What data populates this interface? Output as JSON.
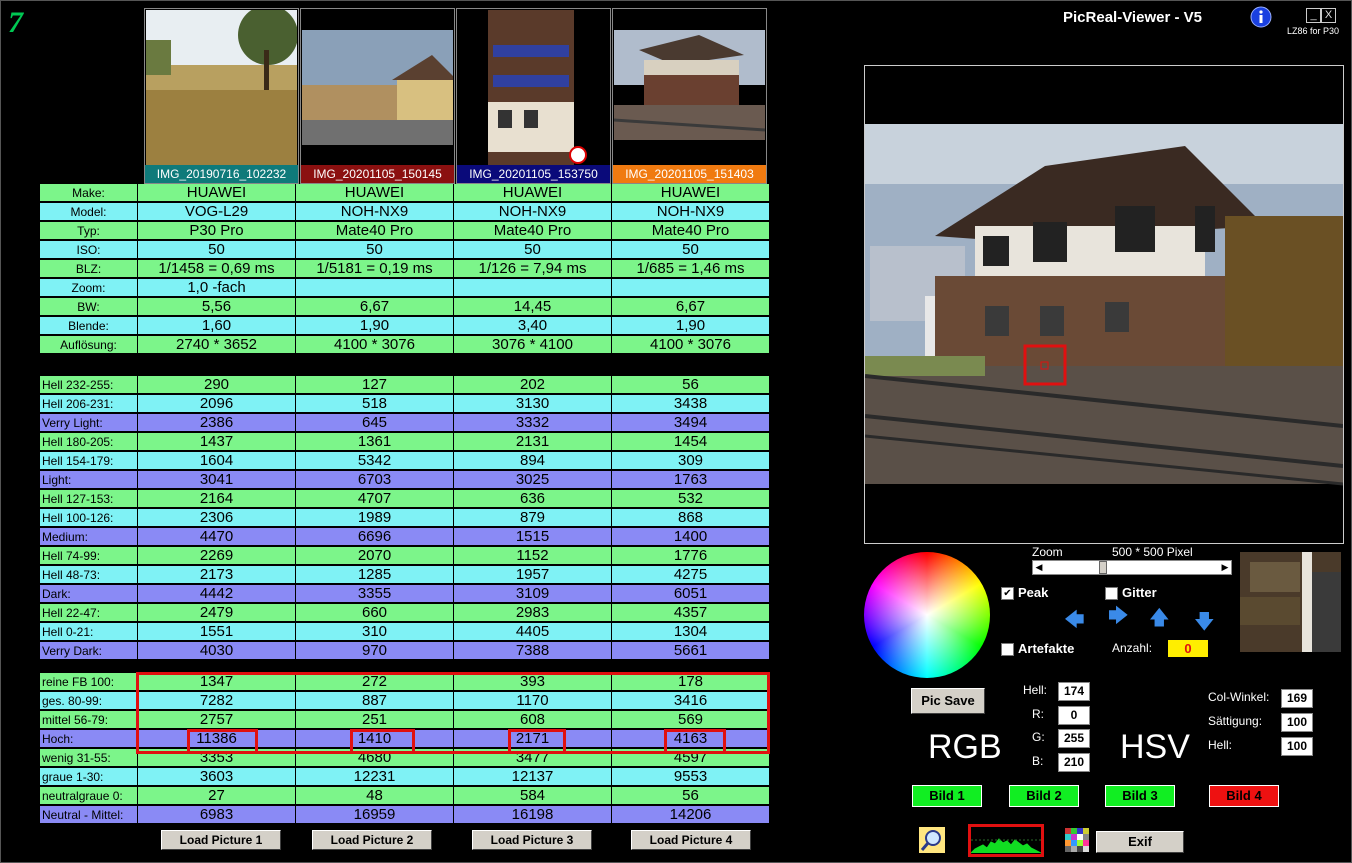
{
  "app": {
    "title": "PicReal-Viewer - V5",
    "subtitle": "LZ86 for P30",
    "minimize": "_",
    "close": "X",
    "logo_glyph": "7"
  },
  "thumbnails": [
    {
      "caption": "IMG_20190716_102232",
      "color": "#0f7a7a"
    },
    {
      "caption": "IMG_20201105_150145",
      "color": "#8b1010"
    },
    {
      "caption": "IMG_20201105_153750",
      "color": "#0a0a7a"
    },
    {
      "caption": "IMG_20201105_151403",
      "color": "#f07a10"
    }
  ],
  "meta_rows": [
    {
      "label": "Make:",
      "color": "g",
      "values": [
        "HUAWEI",
        "HUAWEI",
        "HUAWEI",
        "HUAWEI"
      ]
    },
    {
      "label": "Model:",
      "color": "c",
      "values": [
        "VOG-L29",
        "NOH-NX9",
        "NOH-NX9",
        "NOH-NX9"
      ]
    },
    {
      "label": "Typ:",
      "color": "g",
      "values": [
        "P30 Pro",
        "Mate40 Pro",
        "Mate40 Pro",
        "Mate40 Pro"
      ]
    },
    {
      "label": "ISO:",
      "color": "c",
      "values": [
        "50",
        "50",
        "50",
        "50"
      ]
    },
    {
      "label": "BLZ:",
      "color": "g",
      "values": [
        "1/1458 = 0,69 ms",
        "1/5181 = 0,19 ms",
        "1/126 = 7,94 ms",
        "1/685 = 1,46 ms"
      ]
    },
    {
      "label": "Zoom:",
      "color": "c",
      "values": [
        "1,0 -fach",
        "",
        "",
        ""
      ]
    },
    {
      "label": "BW:",
      "color": "g",
      "values": [
        "5,56",
        "6,67",
        "14,45",
        "6,67"
      ]
    },
    {
      "label": "Blende:",
      "color": "c",
      "values": [
        "1,60",
        "1,90",
        "3,40",
        "1,90"
      ]
    },
    {
      "label": "Auflösung:",
      "color": "g",
      "values": [
        "2740 * 3652",
        "4100 * 3076",
        "3076 * 4100",
        "4100 * 3076"
      ]
    }
  ],
  "bright_rows": [
    {
      "label": "Hell 232-255:",
      "color": "g",
      "values": [
        "290",
        "127",
        "202",
        "56"
      ]
    },
    {
      "label": "Hell 206-231:",
      "color": "c",
      "values": [
        "2096",
        "518",
        "3130",
        "3438"
      ]
    },
    {
      "label": "Verry Light:",
      "color": "p",
      "values": [
        "2386",
        "645",
        "3332",
        "3494"
      ]
    },
    {
      "label": "Hell 180-205:",
      "color": "g",
      "values": [
        "1437",
        "1361",
        "2131",
        "1454"
      ]
    },
    {
      "label": "Hell 154-179:",
      "color": "c",
      "values": [
        "1604",
        "5342",
        "894",
        "309"
      ]
    },
    {
      "label": "Light:",
      "color": "p",
      "values": [
        "3041",
        "6703",
        "3025",
        "1763"
      ]
    },
    {
      "label": "Hell 127-153:",
      "color": "g",
      "values": [
        "2164",
        "4707",
        "636",
        "532"
      ]
    },
    {
      "label": "Hell 100-126:",
      "color": "c",
      "values": [
        "2306",
        "1989",
        "879",
        "868"
      ]
    },
    {
      "label": "Medium:",
      "color": "p",
      "values": [
        "4470",
        "6696",
        "1515",
        "1400"
      ]
    },
    {
      "label": "Hell 74-99:",
      "color": "g",
      "values": [
        "2269",
        "2070",
        "1152",
        "1776"
      ]
    },
    {
      "label": "Hell 48-73:",
      "color": "c",
      "values": [
        "2173",
        "1285",
        "1957",
        "4275"
      ]
    },
    {
      "label": "Dark:",
      "color": "p",
      "values": [
        "4442",
        "3355",
        "3109",
        "6051"
      ]
    },
    {
      "label": "Hell 22-47:",
      "color": "g",
      "values": [
        "2479",
        "660",
        "2983",
        "4357"
      ]
    },
    {
      "label": "Hell 0-21:",
      "color": "c",
      "values": [
        "1551",
        "310",
        "4405",
        "1304"
      ]
    },
    {
      "label": "Verry Dark:",
      "color": "p",
      "values": [
        "4030",
        "970",
        "7388",
        "5661"
      ]
    }
  ],
  "sat_rows": [
    {
      "label": "reine FB 100:",
      "color": "g",
      "values": [
        "1347",
        "272",
        "393",
        "178"
      ]
    },
    {
      "label": "ges. 80-99:",
      "color": "c",
      "values": [
        "7282",
        "887",
        "1170",
        "3416"
      ]
    },
    {
      "label": "mittel 56-79:",
      "color": "g",
      "values": [
        "2757",
        "251",
        "608",
        "569"
      ]
    },
    {
      "label": "Hoch:",
      "color": "p",
      "values": [
        "11386",
        "1410",
        "2171",
        "4163"
      ]
    },
    {
      "label": "wenig 31-55:",
      "color": "g",
      "values": [
        "3353",
        "4680",
        "3477",
        "4597"
      ]
    },
    {
      "label": "graue  1-30:",
      "color": "c",
      "values": [
        "3603",
        "12231",
        "12137",
        "9553"
      ]
    },
    {
      "label": "neutralgraue 0:",
      "color": "g",
      "values": [
        "27",
        "48",
        "584",
        "56"
      ]
    },
    {
      "label": "Neutral - Mittel:",
      "color": "p",
      "values": [
        "6983",
        "16959",
        "16198",
        "14206"
      ]
    }
  ],
  "load_buttons": [
    "Load Picture 1",
    "Load Picture 2",
    "Load Picture 3",
    "Load Picture 4"
  ],
  "zoom": {
    "label": "Zoom",
    "pixel_label": "500 * 500 Pixel",
    "slider_fraction": 0.3
  },
  "controls": {
    "peak_label": "Peak",
    "peak_checked": true,
    "gitter_label": "Gitter",
    "gitter_checked": false,
    "artefakte_label": "Artefakte",
    "artefakte_checked": false,
    "anzahl_label": "Anzahl:",
    "anzahl_value": "0"
  },
  "rgb": {
    "heading": "RGB",
    "hell_label": "Hell:",
    "hell": "174",
    "r_label": "R:",
    "r": "0",
    "g_label": "G:",
    "g": "255",
    "b_label": "B:",
    "b": "210"
  },
  "hsv": {
    "heading": "HSV",
    "winkel_label": "Col-Winkel:",
    "winkel": "169",
    "saet_label": "Sättigung:",
    "saet": "100",
    "hell_label": "Hell:",
    "hell": "100"
  },
  "pic_save": "Pic Save",
  "bild_buttons": [
    {
      "label": "Bild 1",
      "color": "#11ee22"
    },
    {
      "label": "Bild 2",
      "color": "#11ee22"
    },
    {
      "label": "Bild 3",
      "color": "#11ee22"
    },
    {
      "label": "Bild 4",
      "color": "#ee1111"
    }
  ],
  "exif": "Exif",
  "icons": [
    "magnifier-icon",
    "histogram-icon",
    "color-grid-icon",
    "arrow-left-icon",
    "arrow-right-icon",
    "arrow-up-icon",
    "arrow-down-icon",
    "info-icon"
  ],
  "colors": {
    "green_row": "#7cf58a",
    "cyan_row": "#7ff2f5",
    "purple_row": "#8a8af5",
    "highlight": "#e01010"
  }
}
